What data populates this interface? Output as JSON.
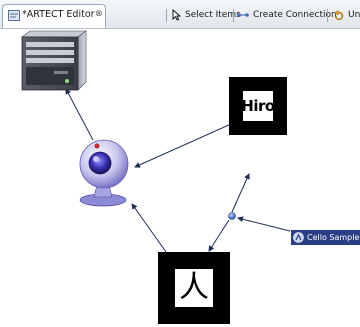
{
  "editor_tab": {
    "title": "*ARTECT Editor",
    "close_glyph": "⊗",
    "icon": "editor-icon"
  },
  "toolbar": {
    "select_items": "Select Items",
    "create_connection": "Create Connection",
    "undo": "Undo"
  },
  "diagram": {
    "nodes": [
      {
        "id": "computer",
        "icon": "computer-tower-icon"
      },
      {
        "id": "webcam",
        "icon": "webcam-icon"
      },
      {
        "id": "hiro-marker",
        "label": "Hiro"
      },
      {
        "id": "kanji-marker",
        "label": "人"
      },
      {
        "id": "connector-point",
        "icon": "junction-dot-icon"
      },
      {
        "id": "cello-sample",
        "label": "Cello Sample",
        "icon": "cello-icon"
      }
    ],
    "connections": [
      {
        "from": "webcam",
        "to": "computer"
      },
      {
        "from": "hiro-marker",
        "to": "webcam"
      },
      {
        "from": "kanji-marker",
        "to": "webcam"
      },
      {
        "from": "connector-point",
        "to": "kanji-marker"
      },
      {
        "from": "connector-point",
        "to": "hiro-marker"
      },
      {
        "from": "cello-sample",
        "to": "connector-point"
      }
    ]
  },
  "colors": {
    "label_bg": "#2b3f86",
    "connector": "#1f2d52",
    "junction": "#4a78c8"
  }
}
